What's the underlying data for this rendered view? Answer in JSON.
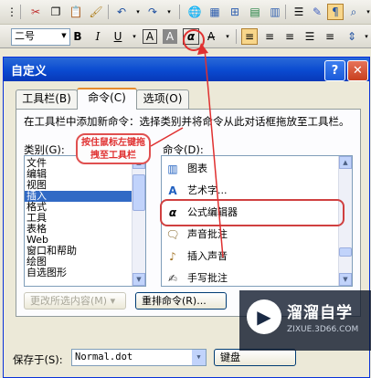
{
  "toolbar": {
    "font_size_value": "二号",
    "bold_label": "B",
    "italic_label": "I",
    "underline_label": "U",
    "char_border_label": "A",
    "char_shade_label": "A",
    "equation_label": "α"
  },
  "dialog": {
    "title": "自定义",
    "help_label": "?",
    "close_label": "✕",
    "tabs": [
      {
        "label": "工具栏(B)"
      },
      {
        "label": "命令(C)"
      },
      {
        "label": "选项(O)"
      }
    ],
    "instruction": "在工具栏中添加新命令：选择类别并将命令从此对话框拖放至工具栏。",
    "categories_label": "类别(G):",
    "commands_label": "命令(D):",
    "categories": [
      "文件",
      "编辑",
      "视图",
      "插入",
      "格式",
      "工具",
      "表格",
      "Web",
      "窗口和帮助",
      "绘图",
      "自选图形"
    ],
    "selected_category": "插入",
    "commands": [
      {
        "label": "图表",
        "icon": "chart-icon"
      },
      {
        "label": "艺术字...",
        "icon": "wordart-icon"
      },
      {
        "label": "公式编辑器",
        "icon": "equation-icon"
      },
      {
        "label": "声音批注",
        "icon": "sound-comment-icon"
      },
      {
        "label": "插入声音",
        "icon": "insert-sound-icon"
      },
      {
        "label": "手写批注",
        "icon": "handwriting-icon"
      }
    ],
    "modify_selection_label": "更改所选内容(M) ▾",
    "rearrange_label": "重排命令(R)...",
    "save_in_label": "保存于(S):",
    "save_in_value": "Normal.dot",
    "keyboard_label": "键盘"
  },
  "annotation": {
    "callout_text": "按住鼠标左键拖拽至工具栏"
  },
  "watermark": {
    "main": "溜溜自学",
    "sub": "ZIXUE.3D66.COM"
  },
  "colors": {
    "title_bar": "#0a4ad0",
    "selection": "#316ac5",
    "annotation_red": "#e03030"
  }
}
